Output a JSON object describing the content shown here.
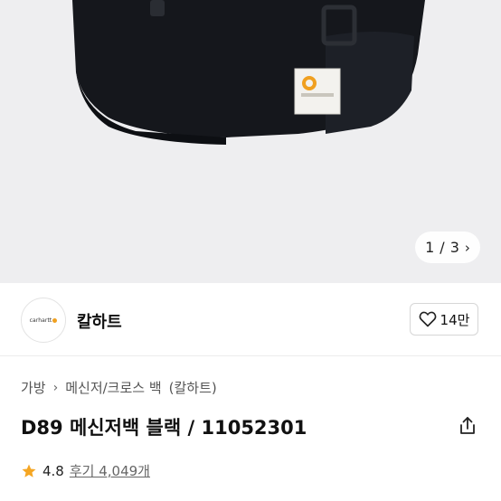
{
  "gallery": {
    "current": "1",
    "separator": "/",
    "total": "3",
    "next_icon": "chevron-right-icon"
  },
  "brand": {
    "logo_text": "carhartt",
    "name": "칼하트",
    "like_icon": "heart-outline-icon",
    "like_count": "14만"
  },
  "breadcrumb": {
    "level1": "가방",
    "level2": "메신저/크로스 백",
    "level3": "(칼하트)",
    "separator_icon": "chevron-right-icon"
  },
  "product": {
    "title": "D89 메신저백 블랙 / 11052301",
    "share_icon": "share-icon"
  },
  "rating": {
    "star_icon": "star-icon",
    "score": "4.8",
    "reviews_label": "후기 4,049개"
  },
  "colors": {
    "star": "#f5a623",
    "logo_accent": "#f0a020",
    "hero_bg": "#eeeef0",
    "bag": "#15171c"
  }
}
